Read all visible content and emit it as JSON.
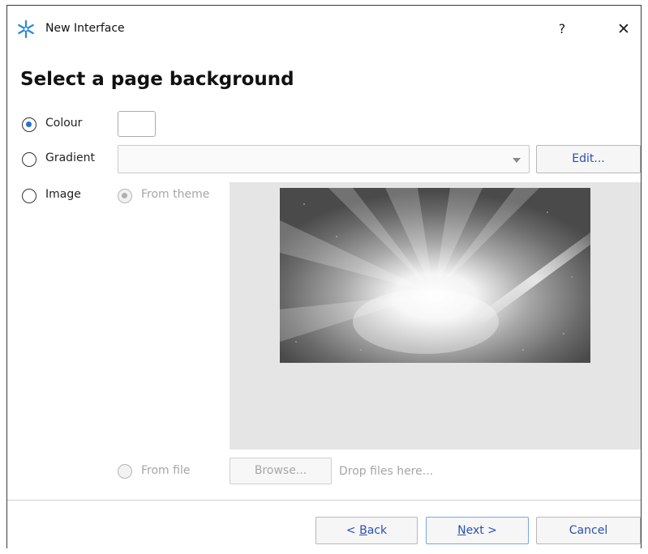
{
  "window": {
    "title": "New Interface",
    "help_label": "?",
    "close_label": "✕",
    "accent_color": "#2a8ad8"
  },
  "page": {
    "heading": "Select a page background"
  },
  "options": {
    "colour": {
      "label": "Colour",
      "selected": true,
      "swatch_color": "#ffffff"
    },
    "gradient": {
      "label": "Gradient",
      "selected": false,
      "value": ""
    },
    "image": {
      "label": "Image",
      "selected": false
    }
  },
  "image_sources": {
    "from_theme": {
      "label": "From theme",
      "selected": true,
      "enabled": false
    },
    "from_file": {
      "label": "From file",
      "selected": false,
      "enabled": false
    }
  },
  "buttons": {
    "edit": "Edit...",
    "browse": "Browse...",
    "back_prefix": "< ",
    "back_key": "B",
    "back_rest": "ack",
    "next_key": "N",
    "next_rest": "ext >",
    "cancel": "Cancel"
  },
  "drop_hint": "Drop files here..."
}
